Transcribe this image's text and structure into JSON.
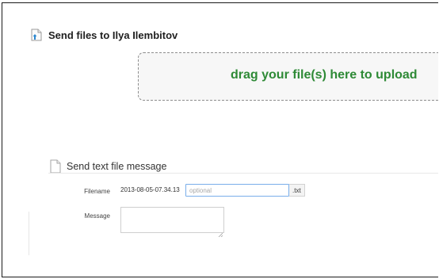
{
  "header": {
    "title": "Send files to Ilya Ilembitov",
    "icon": "file-upload-icon"
  },
  "dropzone": {
    "text": "drag your file(s) here to upload",
    "text_color": "#2e8a36"
  },
  "text_message": {
    "title": "Send text file message",
    "icon": "text-file-icon",
    "filename": {
      "label": "Filename",
      "prefix": "2013-08-05-07.34.13",
      "value": "",
      "placeholder": "optional",
      "suffix": ".txt"
    },
    "message": {
      "label": "Message",
      "value": ""
    }
  }
}
